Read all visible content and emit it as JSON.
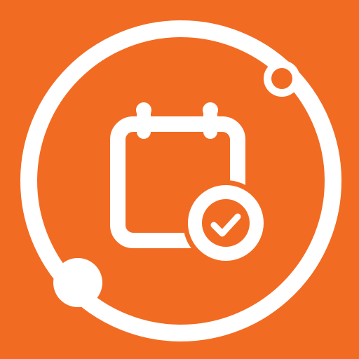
{
  "app_icon": {
    "name": "calendar-check-app-icon",
    "background_color": "#F26B22",
    "foreground_color": "#FFFFFF",
    "icons": {
      "orbit_ring": "orbit-ring-icon",
      "calendar": "calendar-icon",
      "check_badge": "check-circle-icon"
    }
  }
}
